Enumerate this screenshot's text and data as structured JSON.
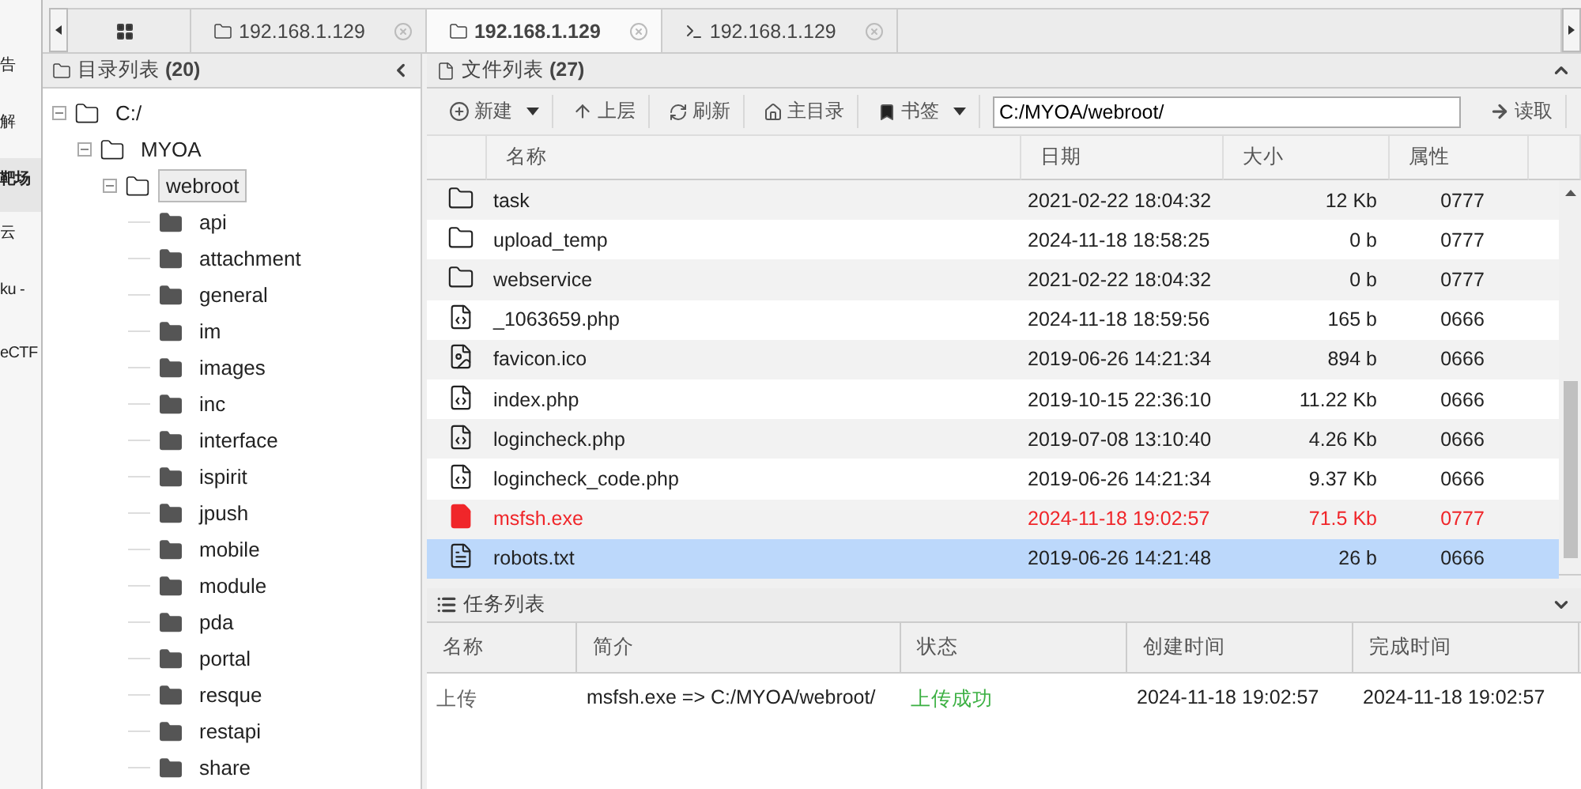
{
  "background_window": {
    "fragments": [
      {
        "text": "告",
        "selected": false
      },
      {
        "text": "解",
        "selected": false
      },
      {
        "text": "靶场",
        "selected": true
      },
      {
        "text": "云",
        "selected": false
      },
      {
        "text": "ku -",
        "selected": false
      },
      {
        "text": "eCTF",
        "selected": false
      }
    ]
  },
  "tabs": [
    {
      "kind": "grid",
      "selected": false
    },
    {
      "kind": "folder",
      "label": "192.168.1.129",
      "selected": false
    },
    {
      "kind": "folder",
      "label": "192.168.1.129",
      "selected": true
    },
    {
      "kind": "terminal",
      "label": "192.168.1.129",
      "selected": false
    }
  ],
  "directory_panel": {
    "title": "目录列表",
    "count": "(20)",
    "tree": [
      {
        "label": "C:/",
        "expanded": true,
        "selected": false,
        "children": [
          {
            "label": "MYOA",
            "expanded": true,
            "selected": false,
            "children": [
              {
                "label": "webroot",
                "expanded": true,
                "selected": true,
                "children": [
                  {
                    "label": "api",
                    "selected": false
                  },
                  {
                    "label": "attachment",
                    "selected": false
                  },
                  {
                    "label": "general",
                    "selected": false
                  },
                  {
                    "label": "im",
                    "selected": false
                  },
                  {
                    "label": "images",
                    "selected": false
                  },
                  {
                    "label": "inc",
                    "selected": false
                  },
                  {
                    "label": "interface",
                    "selected": false
                  },
                  {
                    "label": "ispirit",
                    "selected": false
                  },
                  {
                    "label": "jpush",
                    "selected": false
                  },
                  {
                    "label": "mobile",
                    "selected": false
                  },
                  {
                    "label": "module",
                    "selected": false
                  },
                  {
                    "label": "pda",
                    "selected": false
                  },
                  {
                    "label": "portal",
                    "selected": false
                  },
                  {
                    "label": "resque",
                    "selected": false
                  },
                  {
                    "label": "restapi",
                    "selected": false
                  },
                  {
                    "label": "share",
                    "selected": false
                  }
                ]
              }
            ]
          }
        ]
      }
    ]
  },
  "file_panel": {
    "title": "文件列表",
    "count": "(27)",
    "toolbar": [
      {
        "kind": "new",
        "label": "新建",
        "dropdown": true
      },
      {
        "kind": "up",
        "label": "上层",
        "dropdown": false
      },
      {
        "kind": "refresh",
        "label": "刷新",
        "dropdown": false
      },
      {
        "kind": "home",
        "label": "主目录",
        "dropdown": false
      },
      {
        "kind": "bookmark",
        "label": "书签",
        "dropdown": true
      }
    ],
    "path": "C:/MYOA/webroot/",
    "read_button": "读取",
    "columns": [
      "名称",
      "日期",
      "大小",
      "属性"
    ],
    "rows": [
      {
        "kind": "folder",
        "name": "task",
        "date": "2021-02-22 18:04:32",
        "size": "12 Kb",
        "attr": "0777",
        "alert": false,
        "selected": false
      },
      {
        "kind": "folder",
        "name": "upload_temp",
        "date": "2024-11-18 18:58:25",
        "size": "0 b",
        "attr": "0777",
        "alert": false,
        "selected": false
      },
      {
        "kind": "folder",
        "name": "webservice",
        "date": "2021-02-22 18:04:32",
        "size": "0 b",
        "attr": "0777",
        "alert": false,
        "selected": false
      },
      {
        "kind": "code",
        "name": "_1063659.php",
        "date": "2024-11-18 18:59:56",
        "size": "165 b",
        "attr": "0666",
        "alert": false,
        "selected": false
      },
      {
        "kind": "image",
        "name": "favicon.ico",
        "date": "2019-06-26 14:21:34",
        "size": "894 b",
        "attr": "0666",
        "alert": false,
        "selected": false
      },
      {
        "kind": "code",
        "name": "index.php",
        "date": "2019-10-15 22:36:10",
        "size": "11.22 Kb",
        "attr": "0666",
        "alert": false,
        "selected": false
      },
      {
        "kind": "code",
        "name": "logincheck.php",
        "date": "2019-07-08 13:10:40",
        "size": "4.26 Kb",
        "attr": "0666",
        "alert": false,
        "selected": false
      },
      {
        "kind": "code",
        "name": "logincheck_code.php",
        "date": "2019-06-26 14:21:34",
        "size": "9.37 Kb",
        "attr": "0666",
        "alert": false,
        "selected": false
      },
      {
        "kind": "binary",
        "name": "msfsh.exe",
        "date": "2024-11-18 19:02:57",
        "size": "71.5 Kb",
        "attr": "0777",
        "alert": true,
        "selected": false
      },
      {
        "kind": "text",
        "name": "robots.txt",
        "date": "2019-06-26 14:21:48",
        "size": "26 b",
        "attr": "0666",
        "alert": false,
        "selected": true
      }
    ]
  },
  "task_panel": {
    "title": "任务列表",
    "columns": [
      "名称",
      "简介",
      "状态",
      "创建时间",
      "完成时间"
    ],
    "rows": [
      {
        "name": "上传",
        "summary": "msfsh.exe => C:/MYOA/webroot/",
        "status": "上传成功",
        "color": "#3cb043",
        "created": "2024-11-18 19:02:57",
        "finished": "2024-11-18 19:02:57"
      }
    ]
  }
}
